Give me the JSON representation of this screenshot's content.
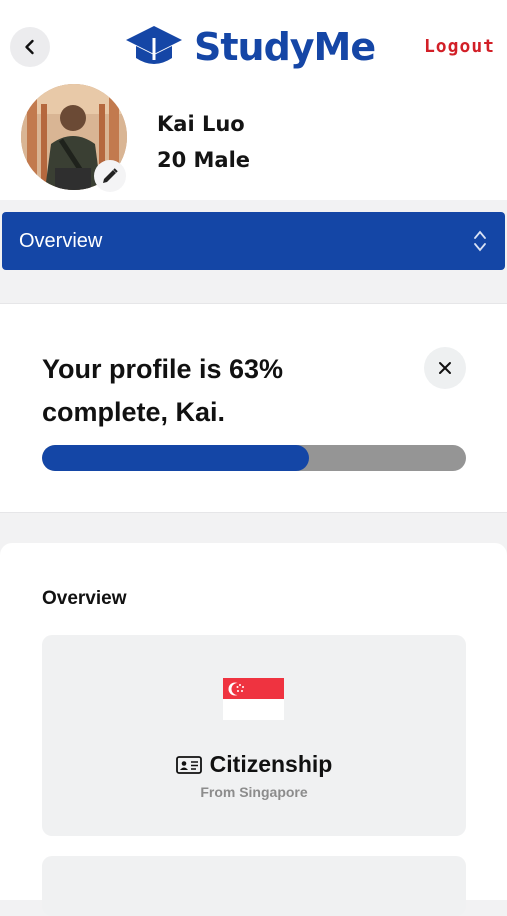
{
  "app": {
    "brand": "StudyMe",
    "brand_parts": [
      "Study",
      "Me"
    ],
    "logout_label": "Logout"
  },
  "user": {
    "name": "Kai Luo",
    "meta": "20 Male"
  },
  "section_select": {
    "selected": "Overview"
  },
  "profile_progress": {
    "title": "Your profile is 63% complete, Kai.",
    "percent": 63
  },
  "overview": {
    "heading": "Overview",
    "items": [
      {
        "title": "Citizenship",
        "subtitle": "From Singapore",
        "icon": "id-card-icon",
        "flag": "singapore-flag"
      }
    ]
  },
  "colors": {
    "brand_blue": "#1446a6",
    "logout_red": "#d21f27",
    "bar_track": "#959595"
  }
}
